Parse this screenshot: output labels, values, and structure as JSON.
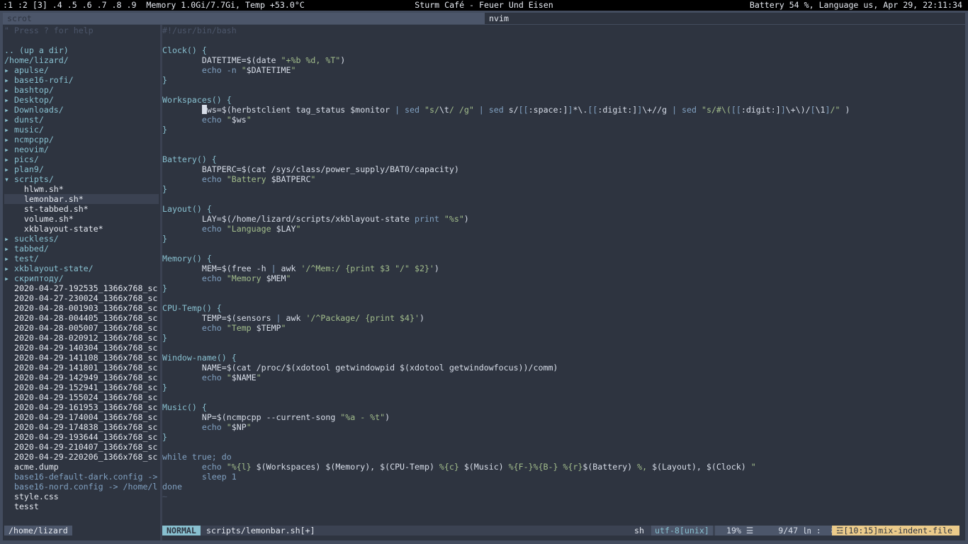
{
  "topbar": {
    "left": ":1 :2 [3] .4 .5 .6 .7 .8 .9  Memory 1.0Gi/7.7Gi, Temp +53.0°C",
    "center": "Sturm Café - Feuer Und Eisen",
    "right": "Battery 54 %, Language us, Apr 29, 22:11:34"
  },
  "tabs": [
    {
      "label": "scrot"
    },
    {
      "label": "nvim"
    }
  ],
  "file_manager": {
    "help": "\" Press ? for help",
    "up": ".. (up a dir)",
    "cwd_line": "/home/lizard/",
    "entries": [
      {
        "text": "▸ apulse/",
        "kind": "dir"
      },
      {
        "text": "▸ base16-rofi/",
        "kind": "dir"
      },
      {
        "text": "▸ bashtop/",
        "kind": "dir"
      },
      {
        "text": "▸ Desktop/",
        "kind": "dir"
      },
      {
        "text": "▸ Downloads/",
        "kind": "dir"
      },
      {
        "text": "▸ dunst/",
        "kind": "dir"
      },
      {
        "text": "▸ music/",
        "kind": "dir"
      },
      {
        "text": "▸ ncmpcpp/",
        "kind": "dir"
      },
      {
        "text": "▸ neovim/",
        "kind": "dir"
      },
      {
        "text": "▸ pics/",
        "kind": "dir"
      },
      {
        "text": "▸ plan9/",
        "kind": "dir"
      },
      {
        "text": "▾ scripts/",
        "kind": "dir"
      },
      {
        "text": "    hlwm.sh*",
        "kind": "file"
      },
      {
        "text": "    lemonbar.sh*",
        "kind": "file",
        "selected": true
      },
      {
        "text": "    st-tabbed.sh*",
        "kind": "file"
      },
      {
        "text": "    volume.sh*",
        "kind": "file"
      },
      {
        "text": "    xkblayout-state*",
        "kind": "file"
      },
      {
        "text": "▸ suckless/",
        "kind": "dir"
      },
      {
        "text": "▸ tabbed/",
        "kind": "dir"
      },
      {
        "text": "▸ test/",
        "kind": "dir"
      },
      {
        "text": "▸ xkblayout-state/",
        "kind": "dir"
      },
      {
        "text": "▸ скриптоду/",
        "kind": "dir"
      },
      {
        "text": "  2020-04-27-192535_1366x768_sc",
        "kind": "file"
      },
      {
        "text": "  2020-04-27-230024_1366x768_sc",
        "kind": "file"
      },
      {
        "text": "  2020-04-28-001903_1366x768_sc",
        "kind": "file"
      },
      {
        "text": "  2020-04-28-004405_1366x768_sc",
        "kind": "file"
      },
      {
        "text": "  2020-04-28-005007_1366x768_sc",
        "kind": "file"
      },
      {
        "text": "  2020-04-28-020912_1366x768_sc",
        "kind": "file"
      },
      {
        "text": "  2020-04-29-140304_1366x768_sc",
        "kind": "file"
      },
      {
        "text": "  2020-04-29-141108_1366x768_sc",
        "kind": "file"
      },
      {
        "text": "  2020-04-29-141801_1366x768_sc",
        "kind": "file"
      },
      {
        "text": "  2020-04-29-142949_1366x768_sc",
        "kind": "file"
      },
      {
        "text": "  2020-04-29-152941_1366x768_sc",
        "kind": "file"
      },
      {
        "text": "  2020-04-29-155024_1366x768_sc",
        "kind": "file"
      },
      {
        "text": "  2020-04-29-161953_1366x768_sc",
        "kind": "file"
      },
      {
        "text": "  2020-04-29-174004_1366x768_sc",
        "kind": "file"
      },
      {
        "text": "  2020-04-29-174838_1366x768_sc",
        "kind": "file"
      },
      {
        "text": "  2020-04-29-193644_1366x768_sc",
        "kind": "file"
      },
      {
        "text": "  2020-04-29-210407_1366x768_sc",
        "kind": "file"
      },
      {
        "text": "  2020-04-29-220206_1366x768_sc",
        "kind": "file"
      },
      {
        "text": "  acme.dump",
        "kind": "file"
      },
      {
        "text": "  base16-default-dark.config ->",
        "kind": "link"
      },
      {
        "text": "  base16-nord.config -> /home/l",
        "kind": "link"
      },
      {
        "text": "  style.css",
        "kind": "file"
      },
      {
        "text": "  tesst",
        "kind": "file"
      }
    ],
    "status": "/home/lizard"
  },
  "editor": {
    "lines": [
      [
        [
          "#!/usr/bin/bash",
          "comment"
        ]
      ],
      [],
      [
        [
          "Clock() {",
          "func"
        ]
      ],
      [
        [
          "        DATETIME=$(date ",
          "plain"
        ],
        [
          "\"+%b %d, %T\"",
          "str"
        ],
        [
          ")",
          "plain"
        ]
      ],
      [
        [
          "        echo -n ",
          "kw"
        ],
        [
          "\"",
          "str"
        ],
        [
          "$DATETIME",
          "plain"
        ],
        [
          "\"",
          "str"
        ]
      ],
      [
        [
          "}",
          "func"
        ]
      ],
      [],
      [
        [
          "Workspaces() {",
          "func"
        ]
      ],
      [
        [
          "        ",
          "plain"
        ],
        [
          "CURSOR",
          "cursor"
        ],
        [
          "ws=$(herbstclient tag_status $monitor ",
          "plain"
        ],
        [
          "| sed ",
          "kw"
        ],
        [
          "\"s/",
          "str"
        ],
        [
          "\\t",
          "plain"
        ],
        [
          "/ /g\"",
          "str"
        ],
        [
          " | sed ",
          "kw"
        ],
        [
          "s/",
          "plain"
        ],
        [
          "[[",
          "kw"
        ],
        [
          ":space:]",
          "plain"
        ],
        [
          "]",
          "kw"
        ],
        [
          "*\\.",
          "plain"
        ],
        [
          "[[",
          "kw"
        ],
        [
          ":digit:]",
          "plain"
        ],
        [
          "]",
          "kw"
        ],
        [
          "\\+//g ",
          "plain"
        ],
        [
          "| sed ",
          "kw"
        ],
        [
          "\"s/#\\(",
          "str"
        ],
        [
          "[[",
          "kw"
        ],
        [
          ":digit:]",
          "plain"
        ],
        [
          "]",
          "kw"
        ],
        [
          "\\+\\)/",
          "plain"
        ],
        [
          "[",
          "kw"
        ],
        [
          "\\1",
          "plain"
        ],
        [
          "]",
          "kw"
        ],
        [
          "/\"",
          "str"
        ],
        [
          " )",
          "plain"
        ]
      ],
      [
        [
          "        echo ",
          "kw"
        ],
        [
          "\"",
          "str"
        ],
        [
          "$ws",
          "plain"
        ],
        [
          "\"",
          "str"
        ]
      ],
      [
        [
          "}",
          "func"
        ]
      ],
      [],
      [],
      [
        [
          "Battery() {",
          "func"
        ]
      ],
      [
        [
          "        BATPERC=$(cat /sys/class/power_supply/BAT0/capacity)",
          "plain"
        ]
      ],
      [
        [
          "        echo ",
          "kw"
        ],
        [
          "\"Battery ",
          "str"
        ],
        [
          "$BATPERC",
          "plain"
        ],
        [
          "\"",
          "str"
        ]
      ],
      [
        [
          "}",
          "func"
        ]
      ],
      [],
      [
        [
          "Layout() {",
          "func"
        ]
      ],
      [
        [
          "        LAY=$(/home/lizard/scripts/xkblayout-state ",
          "plain"
        ],
        [
          "print ",
          "kw"
        ],
        [
          "\"%s\"",
          "str"
        ],
        [
          ")",
          "plain"
        ]
      ],
      [
        [
          "        echo ",
          "kw"
        ],
        [
          "\"Language ",
          "str"
        ],
        [
          "$LAY",
          "plain"
        ],
        [
          "\"",
          "str"
        ]
      ],
      [
        [
          "}",
          "func"
        ]
      ],
      [],
      [
        [
          "Memory() {",
          "func"
        ]
      ],
      [
        [
          "        MEM=$(free -h ",
          "plain"
        ],
        [
          "| ",
          "kw"
        ],
        [
          "awk ",
          "plain"
        ],
        [
          "'/^Mem:/ {print $3 \"/\" $2}'",
          "str"
        ],
        [
          ")",
          "plain"
        ]
      ],
      [
        [
          "        echo ",
          "kw"
        ],
        [
          "\"Memory ",
          "str"
        ],
        [
          "$MEM",
          "plain"
        ],
        [
          "\"",
          "str"
        ]
      ],
      [
        [
          "}",
          "func"
        ]
      ],
      [],
      [
        [
          "CPU-Temp() {",
          "func"
        ]
      ],
      [
        [
          "        TEMP=$(sensors ",
          "plain"
        ],
        [
          "| ",
          "kw"
        ],
        [
          "awk ",
          "plain"
        ],
        [
          "'/^Package/ {print $4}'",
          "str"
        ],
        [
          ")",
          "plain"
        ]
      ],
      [
        [
          "        echo ",
          "kw"
        ],
        [
          "\"Temp ",
          "str"
        ],
        [
          "$TEMP",
          "plain"
        ],
        [
          "\"",
          "str"
        ]
      ],
      [
        [
          "}",
          "func"
        ]
      ],
      [],
      [
        [
          "Window-name() {",
          "func"
        ]
      ],
      [
        [
          "        NAME=$(cat /proc/$(xdotool getwindowpid $(xdotool getwindowfocus))/comm)",
          "plain"
        ]
      ],
      [
        [
          "        echo ",
          "kw"
        ],
        [
          "\"",
          "str"
        ],
        [
          "$NAME",
          "plain"
        ],
        [
          "\"",
          "str"
        ]
      ],
      [
        [
          "}",
          "func"
        ]
      ],
      [],
      [
        [
          "Music() {",
          "func"
        ]
      ],
      [
        [
          "        NP=$(ncmpcpp --current-song ",
          "plain"
        ],
        [
          "\"%a - %t\"",
          "str"
        ],
        [
          ")",
          "plain"
        ]
      ],
      [
        [
          "        echo ",
          "kw"
        ],
        [
          "\"",
          "str"
        ],
        [
          "$NP",
          "plain"
        ],
        [
          "\"",
          "str"
        ]
      ],
      [
        [
          "}",
          "func"
        ]
      ],
      [],
      [
        [
          "while true; do",
          "kw"
        ]
      ],
      [
        [
          "        echo ",
          "kw"
        ],
        [
          "\"%{l} ",
          "str"
        ],
        [
          "$(Workspaces) $(Memory), $(CPU-Temp) ",
          "plain"
        ],
        [
          "%{c} ",
          "str"
        ],
        [
          "$(Music) ",
          "plain"
        ],
        [
          "%{F-}%{B-} %{r}",
          "str"
        ],
        [
          "$(Battery) ",
          "plain"
        ],
        [
          "%, ",
          "str"
        ],
        [
          "$(Layout), $(Clock) ",
          "plain"
        ],
        [
          "\"",
          "str"
        ]
      ],
      [
        [
          "        sleep 1",
          "kw"
        ]
      ],
      [
        [
          "done",
          "kw"
        ]
      ],
      [
        [
          "~",
          "tilde"
        ]
      ]
    ],
    "statusline": {
      "mode": "NORMAL",
      "file": "scripts/lemonbar.sh[+]",
      "filetype": "sh",
      "encoding": "utf-8[unix]",
      "position": "19% ☰     9/47 ㏑ :  8",
      "warning": "☲[10:15]mix-indent-file"
    }
  },
  "colors": {
    "background": "#2e3440",
    "frame": "#434c5e",
    "accent": "#88c0d0",
    "keyword": "#81a1c1",
    "string": "#a3be8c",
    "warning": "#ebcb8b"
  }
}
